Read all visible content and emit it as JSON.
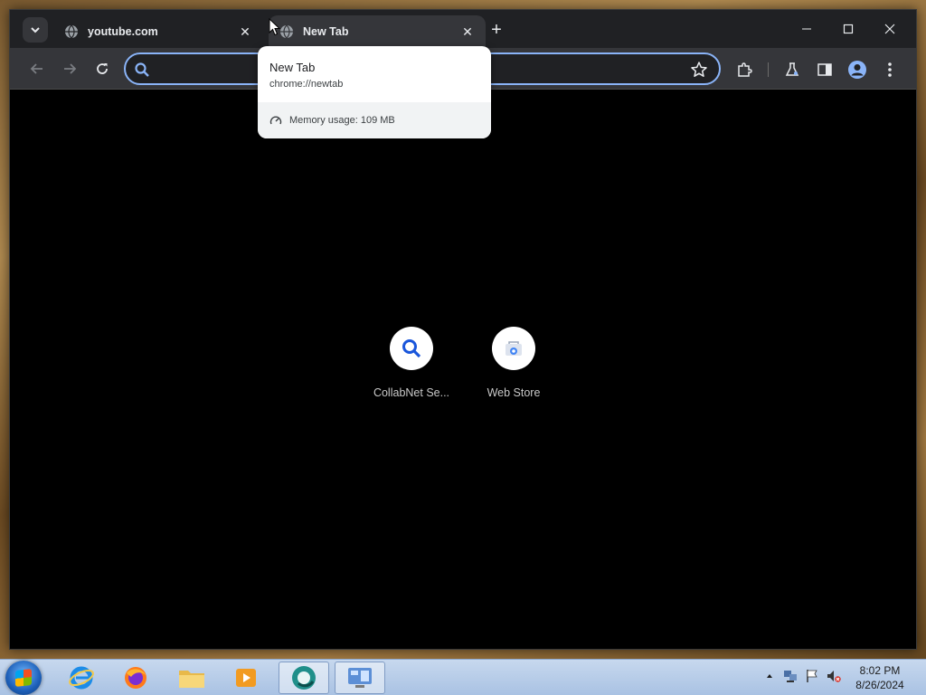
{
  "browser": {
    "tabs": [
      {
        "title": "youtube.com",
        "favicon": "globe-icon"
      },
      {
        "title": "New Tab",
        "favicon": "globe-icon",
        "active": true
      }
    ],
    "omnibox": {
      "value": "",
      "placeholder": ""
    }
  },
  "hovercard": {
    "title": "New Tab",
    "url": "chrome://newtab",
    "memory": "Memory usage: 109 MB"
  },
  "shortcuts": [
    {
      "label": "CollabNet Se...",
      "icon": "search-icon"
    },
    {
      "label": "Web Store",
      "icon": "web-store-icon"
    }
  ],
  "taskbar": {
    "time": "8:02 PM",
    "date": "8/26/2024"
  },
  "colors": {
    "accent": "#8ab4f8",
    "chrome_dark": "#202124",
    "toolbar": "#35363a"
  }
}
